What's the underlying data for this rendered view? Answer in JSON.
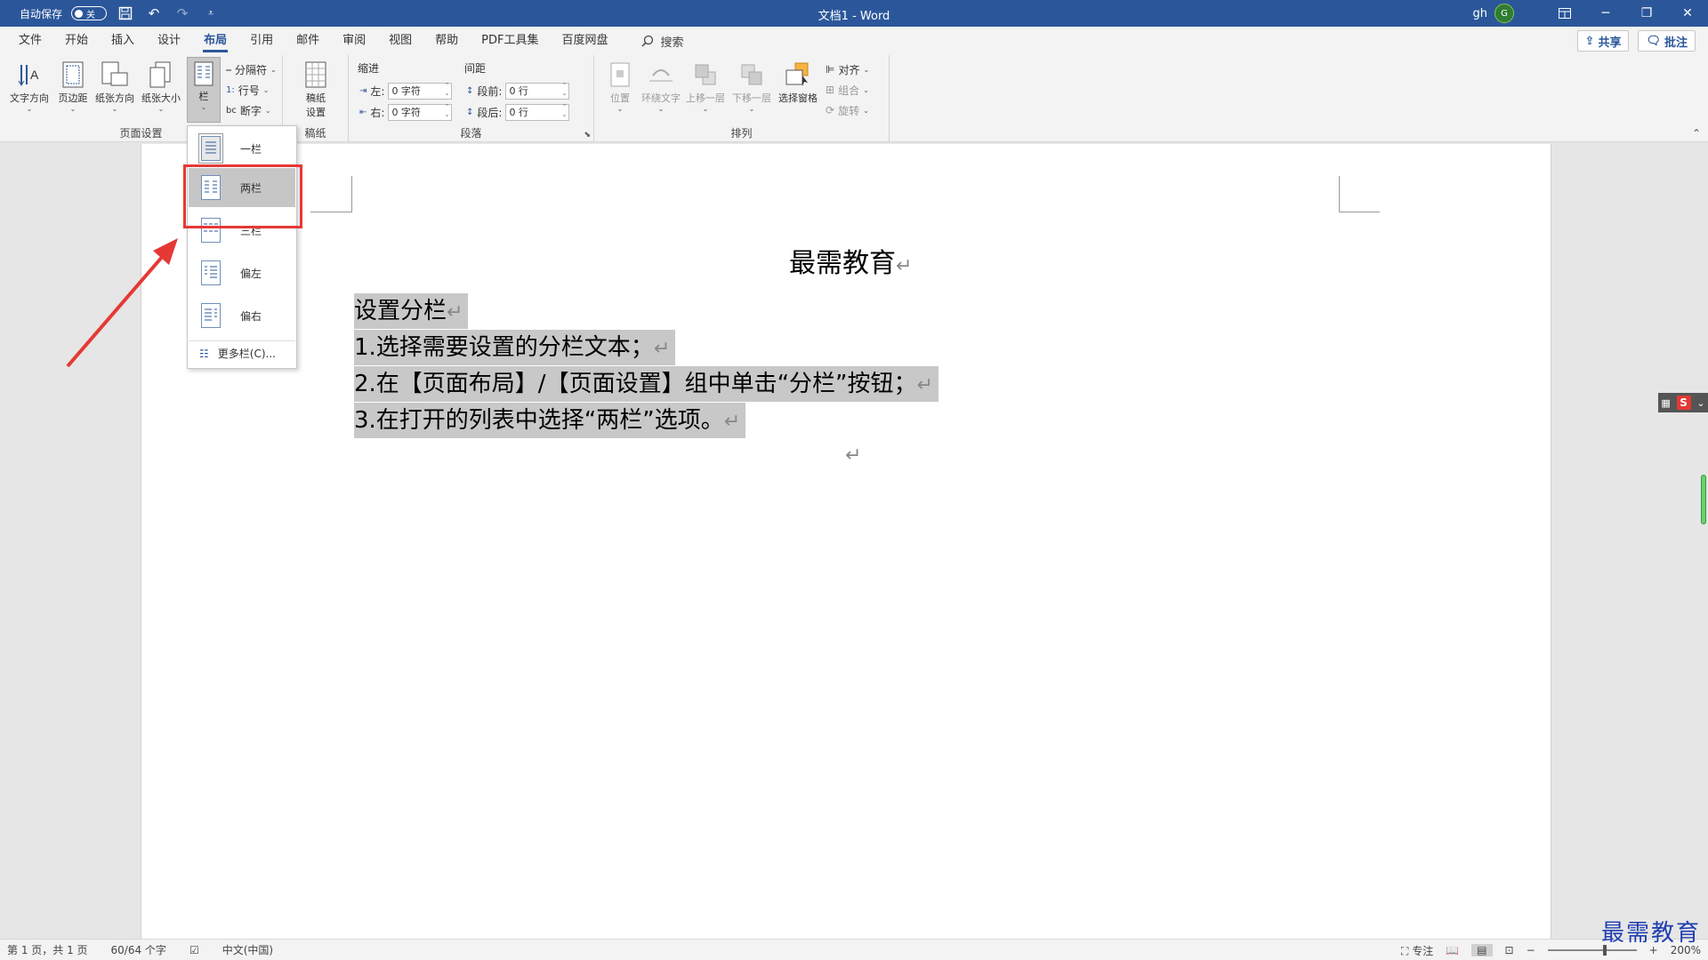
{
  "titlebar": {
    "autosave_label": "自动保存",
    "autosave_state": "关",
    "doc_title": "文档1  -  Word",
    "user_name": "gh",
    "avatar_initial": "G"
  },
  "menu": {
    "tabs": [
      "文件",
      "开始",
      "插入",
      "设计",
      "布局",
      "引用",
      "邮件",
      "审阅",
      "视图",
      "帮助",
      "PDF工具集",
      "百度网盘"
    ],
    "active_tab": "布局",
    "search_label": "搜索",
    "share_label": "共享",
    "comment_label": "批注"
  },
  "ribbon": {
    "page_setup": {
      "label": "页面设置",
      "text_direction": "文字方向",
      "margins": "页边距",
      "orientation": "纸张方向",
      "size": "纸张大小",
      "columns": "栏",
      "breaks": "分隔符",
      "line_numbers": "行号",
      "hyphenation": "断字"
    },
    "manuscript": {
      "label": "稿纸",
      "settings": "稿纸\n设置"
    },
    "paragraph": {
      "label": "段落",
      "indent_label": "缩进",
      "spacing_label": "间距",
      "left_label": "左:",
      "right_label": "右:",
      "before_label": "段前:",
      "after_label": "段后:",
      "left_value": "0 字符",
      "right_value": "0 字符",
      "before_value": "0 行",
      "after_value": "0 行"
    },
    "arrange": {
      "label": "排列",
      "position": "位置",
      "wrap_text": "环绕文字",
      "bring_forward": "上移一层",
      "send_backward": "下移一层",
      "selection_pane": "选择窗格",
      "align": "对齐",
      "group": "组合",
      "rotate": "旋转"
    }
  },
  "columns_menu": {
    "items": [
      "一栏",
      "两栏",
      "三栏",
      "偏左",
      "偏右"
    ],
    "hovered": "两栏",
    "more": "更多栏(C)..."
  },
  "document": {
    "heading": "最需教育",
    "lines": [
      "设置分栏",
      "1.选择需要设置的分栏文本；",
      "2.在【页面布局】/【页面设置】组中单击“分栏”按钮；",
      "3.在打开的列表中选择“两栏”选项。"
    ],
    "pilcrow": "↵"
  },
  "statusbar": {
    "page_info": "第 1 页，共 1 页",
    "word_count": "60/64 个字",
    "language": "中文(中国)",
    "focus_label": "专注",
    "zoom": "200%",
    "zoom_level": 200
  },
  "watermark": "最需教育",
  "colors": {
    "title_bar": "#2b579a",
    "highlight_box": "#e53935",
    "selection": "#c8c8c8"
  }
}
